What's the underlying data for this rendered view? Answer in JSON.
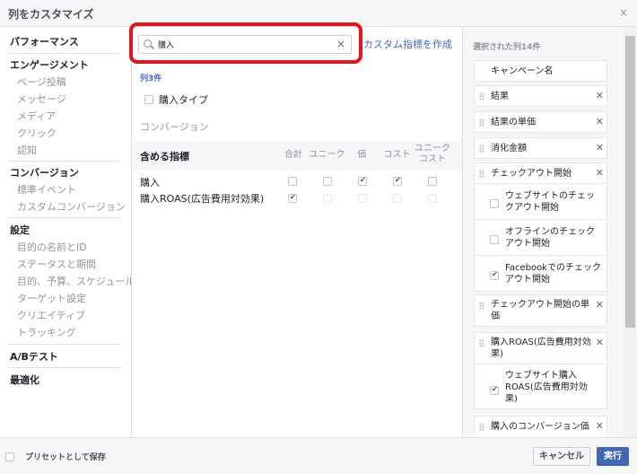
{
  "dialog": {
    "title": "列をカスタマイズ",
    "close_glyph": "×"
  },
  "sidebar": {
    "sections": [
      {
        "label": "パフォーマンス",
        "items": []
      },
      {
        "label": "エンゲージメント",
        "items": [
          "ページ投稿",
          "メッセージ",
          "メディア",
          "クリック",
          "認知"
        ]
      },
      {
        "label": "コンバージョン",
        "items": [
          "標準イベント",
          "カスタムコンバージョン"
        ]
      },
      {
        "label": "設定",
        "items": [
          "目的の名前とID",
          "ステータスと期間",
          "目的、予算、スケジュール",
          "ターゲット設定",
          "クリエイティブ",
          "トラッキング"
        ]
      },
      {
        "label": "A/Bテスト",
        "items": []
      },
      {
        "label": "最適化",
        "items": []
      }
    ]
  },
  "search": {
    "value": "購入",
    "icon": "search-icon",
    "clear_glyph": "×"
  },
  "create_metric_link": "カスタム指標を作成",
  "results": {
    "count_label": "列3件",
    "purchase_type_label": "購入タイプ",
    "conversion_label": "コンバージョン",
    "table": {
      "metric_header": "含める指標",
      "columns": [
        "合計",
        "ユニーク",
        "価",
        "コスト",
        "ユニーク\nコスト"
      ],
      "rows": [
        {
          "label": "購入",
          "checks": [
            false,
            false,
            true,
            true,
            false
          ]
        },
        {
          "label": "購入ROAS(広告費用対効果)",
          "checks": [
            true,
            false,
            false,
            false,
            false
          ]
        }
      ]
    }
  },
  "selected": {
    "count_label": "選択された列14件",
    "items": [
      {
        "label": "キャンペーン名",
        "removable": false
      },
      {
        "label": "結果",
        "removable": true
      },
      {
        "label": "結果の単価",
        "removable": true
      },
      {
        "label": "消化金額",
        "removable": true
      },
      {
        "label": "チェックアウト開始",
        "removable": true,
        "options": [
          {
            "label": "ウェブサイトのチェックアウト開始",
            "checked": false
          },
          {
            "label": "オフラインのチェックアウト開始",
            "checked": false
          },
          {
            "label": "Facebookでのチェックアウト開始",
            "checked": true
          }
        ]
      },
      {
        "label": "チェックアウト開始の単価",
        "removable": true
      },
      {
        "label": "購入ROAS(広告費用対効果)",
        "removable": true,
        "options": [
          {
            "label": "ウェブサイト購入ROAS(広告費用対効果)",
            "checked": true
          }
        ]
      },
      {
        "label": "購入のコンバージョン価",
        "removable": true
      }
    ]
  },
  "footer": {
    "save_preset_label": "プリセットとして保存",
    "cancel_label": "キャンセル",
    "run_label": "実行"
  },
  "colors": {
    "accent": "#4267b2",
    "highlight": "#e4141a"
  }
}
